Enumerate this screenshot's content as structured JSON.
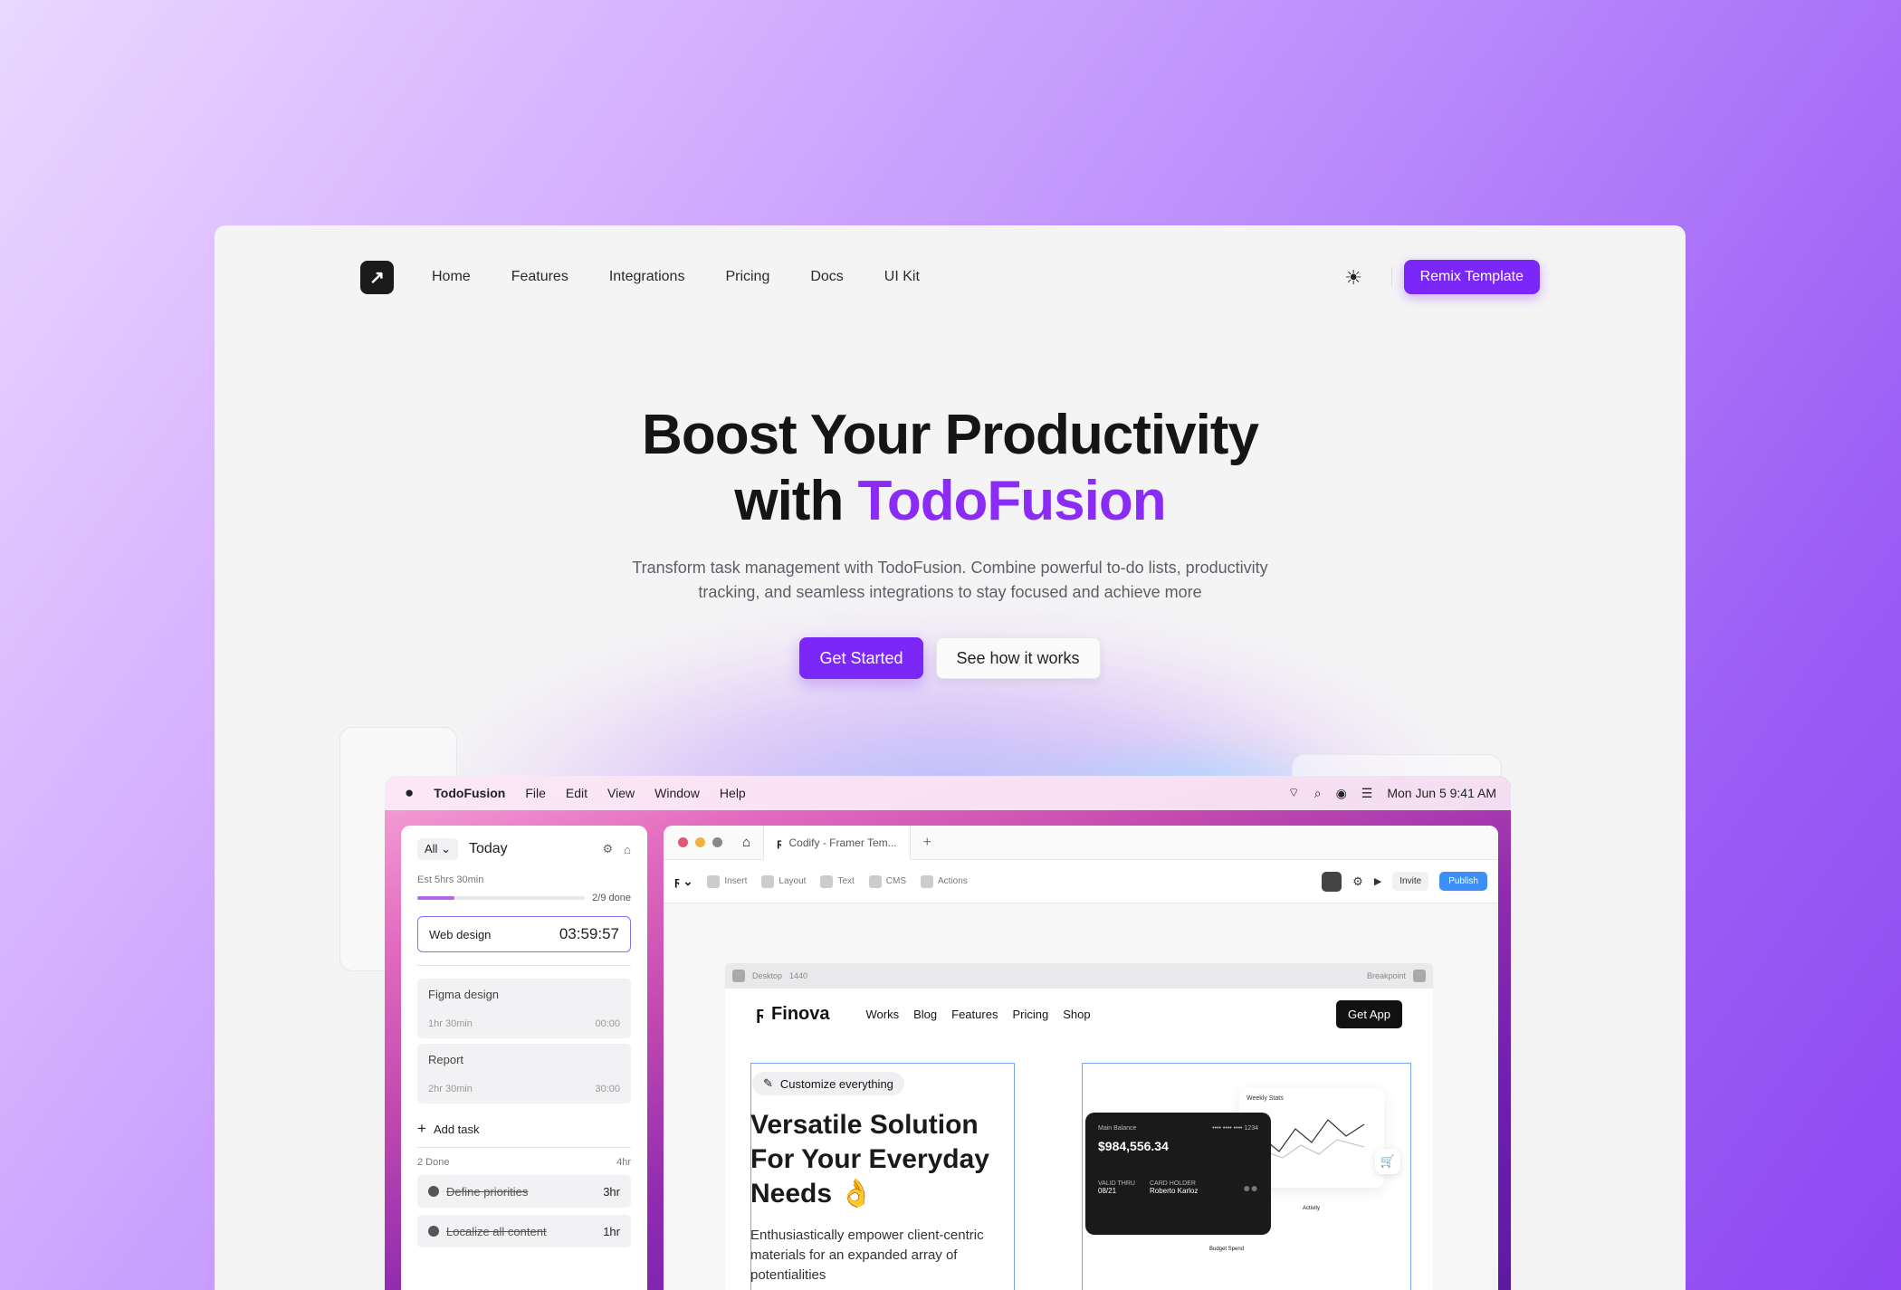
{
  "nav": {
    "links": [
      "Home",
      "Features",
      "Integrations",
      "Pricing",
      "Docs",
      "UI Kit"
    ],
    "cta": "Remix Template"
  },
  "hero": {
    "title_line1": "Boost Your Productivity",
    "title_prefix": "with ",
    "title_accent": "TodoFusion",
    "subtitle": "Transform task management with TodoFusion. Combine powerful to-do lists, productivity tracking, and seamless integrations to stay focused and achieve more",
    "primary_cta": "Get Started",
    "secondary_cta": "See how it works"
  },
  "menubar": {
    "app": "TodoFusion",
    "items": [
      "File",
      "Edit",
      "View",
      "Window",
      "Help"
    ],
    "clock": "Mon Jun 5  9:41 AM"
  },
  "todo": {
    "filter": "All",
    "view": "Today",
    "estimate": "Est 5hrs 30min",
    "progress_label": "2/9 done",
    "progress": 0.22,
    "active_task": "Web design",
    "active_timer": "03:59:57",
    "tasks": [
      {
        "name": "Figma design",
        "duration": "1hr 30min",
        "time": "00:00"
      },
      {
        "name": "Report",
        "duration": "2hr 30min",
        "time": "30:00"
      }
    ],
    "add_task": "Add task",
    "done_label": "2 Done",
    "done_total": "4hr",
    "done_tasks": [
      {
        "name": "Define priorities",
        "hours": "3hr"
      },
      {
        "name": "Localize all content",
        "hours": "1hr"
      }
    ]
  },
  "framer": {
    "tab": "Codify - Framer Tem...",
    "tools": [
      "Insert",
      "Layout",
      "Text",
      "CMS",
      "Actions"
    ],
    "invite": "Invite",
    "publish": "Publish",
    "breakpoint_label": "Desktop",
    "breakpoint_width": "1440",
    "breakpoint_right": "Breakpoint"
  },
  "site": {
    "logo": "Finova",
    "links": [
      "Works",
      "Blog",
      "Features",
      "Pricing",
      "Shop"
    ],
    "cta": "Get App",
    "badge": "Customize everything",
    "title": "Versatile Solution For Your Everyday Needs 👌",
    "desc": "Enthusiastically empower client-centric materials for an expanded array of potentialities",
    "card_label": "Main Balance",
    "card_number": "•••• •••• •••• 1234",
    "card_value": "$984,556.34",
    "valid_label": "VALID THRU",
    "valid": "08/21",
    "holder_label": "CARD HOLDER",
    "holder": "Roberto Karloz",
    "stats_label": "Weekly Stats",
    "activity_label": "Activity",
    "budget_label": "Budget Spend"
  }
}
